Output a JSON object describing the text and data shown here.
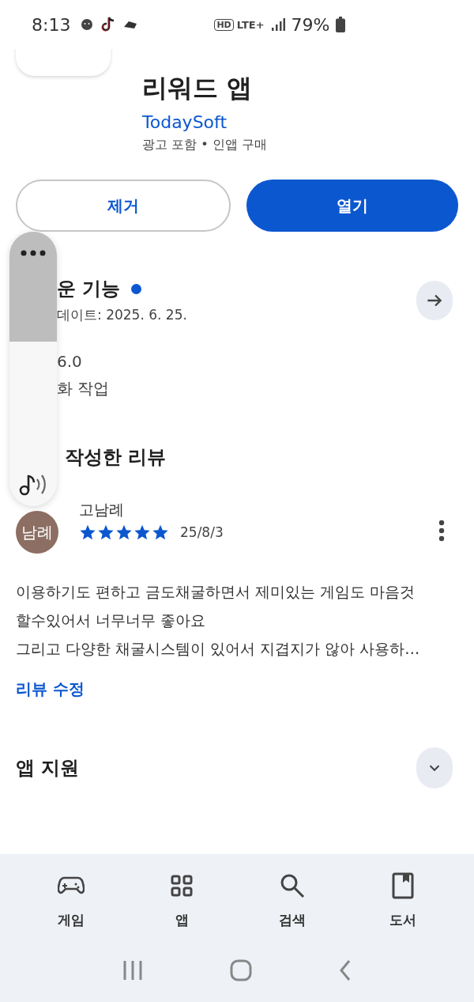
{
  "status_bar": {
    "time": "8:13",
    "hd": "HD",
    "network": "LTE+",
    "battery": "79%"
  },
  "app": {
    "title": "리워드 앱",
    "developer": "TodaySoft",
    "info": "광고 포함 • 인앱 구매"
  },
  "buttons": [
    {
      "label": "제거",
      "kind": "outlined"
    },
    {
      "label": "열기",
      "kind": "filled"
    }
  ],
  "whats_new": {
    "title": "운 기능",
    "new_dot": true,
    "updated": "데이트: 2025. 6. 25.",
    "lines": [
      "6.0",
      "화 작업"
    ]
  },
  "my_review": {
    "title": "작성한 리뷰",
    "avatar": "남례",
    "name": "고남례",
    "stars": 5,
    "date": "25/8/3",
    "text": [
      "이용하기도 편하고 금도채굴하면서 제미있는 게임도 마음것",
      "할수있어서 너무너무 좋아요",
      "그리고 다양한 채굴시스템이 있어서 지겹지가 않아 사용하…"
    ],
    "edit_link": "리뷰 수정"
  },
  "app_support": {
    "title": "앱 지원",
    "expanded": false
  },
  "bottom_nav": [
    {
      "label": "게임",
      "selected": false
    },
    {
      "label": "앱",
      "selected": false
    },
    {
      "label": "검색",
      "selected": false
    },
    {
      "label": "도서",
      "selected": false
    }
  ]
}
